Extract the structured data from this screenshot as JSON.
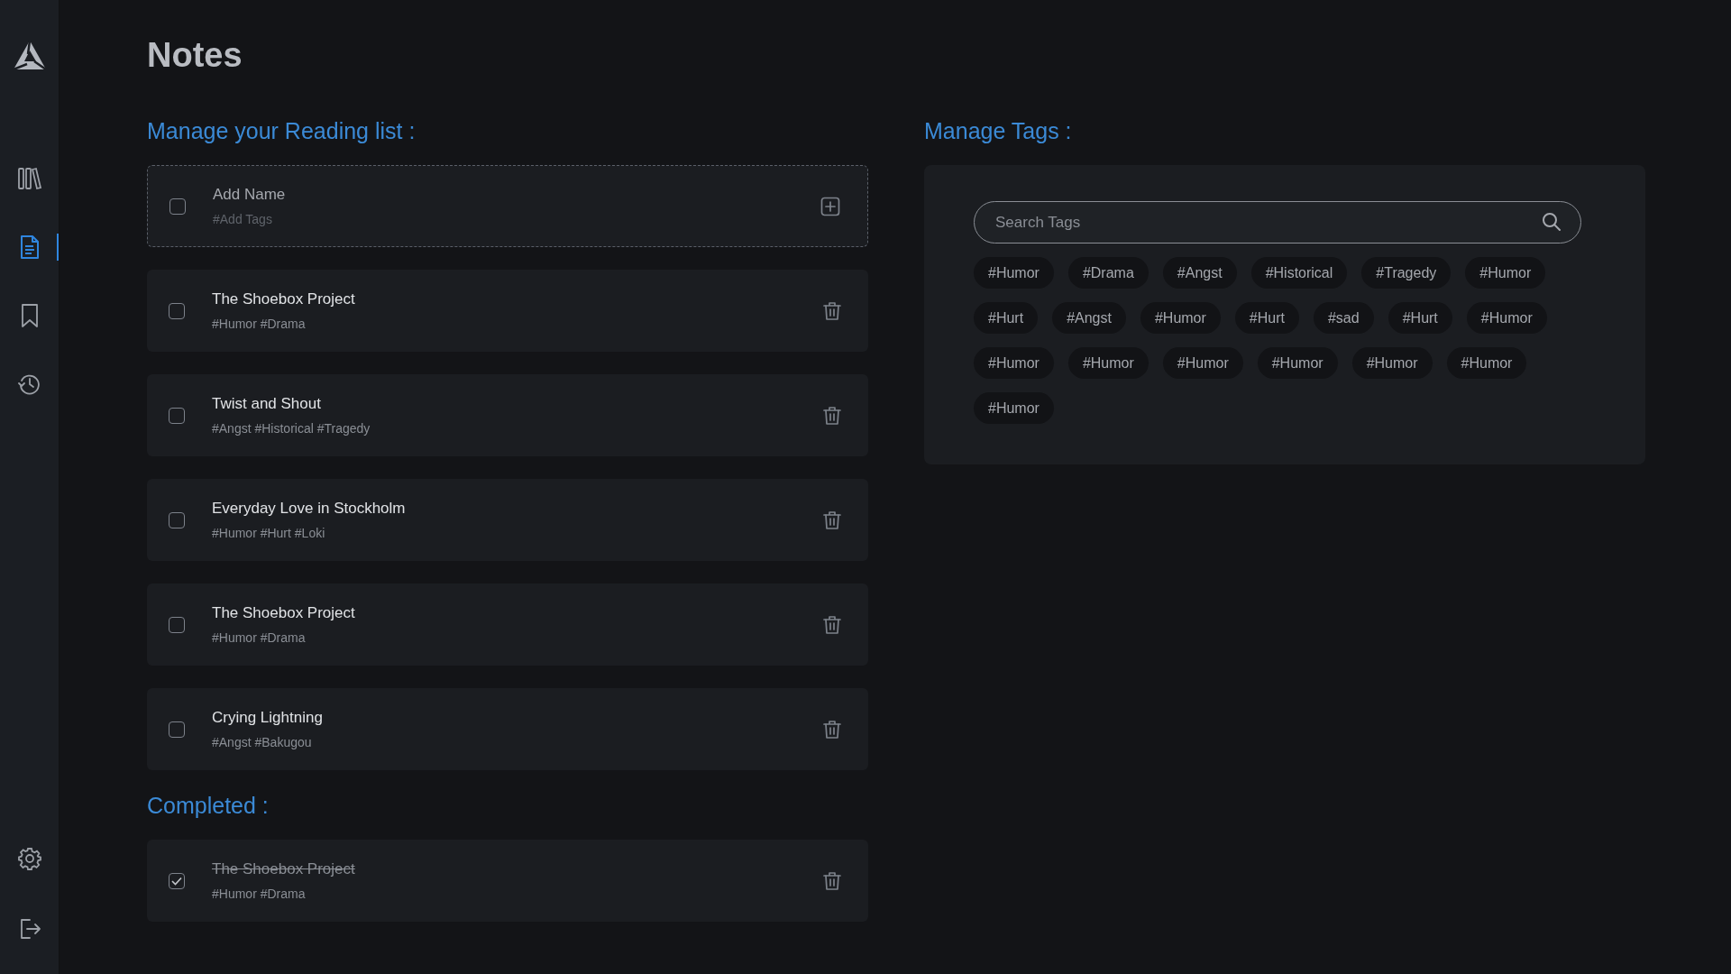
{
  "sidebar": {
    "nav": [
      {
        "kind": "library",
        "selected": false
      },
      {
        "kind": "notes",
        "selected": true
      },
      {
        "kind": "bookmark",
        "selected": false
      },
      {
        "kind": "history",
        "selected": false
      }
    ],
    "bottom": [
      {
        "kind": "settings"
      },
      {
        "kind": "logout"
      }
    ]
  },
  "page": {
    "title": "Notes"
  },
  "reading_list": {
    "heading": "Manage your Reading list :",
    "new_item": {
      "name_placeholder": "Add Name",
      "tags_placeholder": "#Add Tags",
      "checked": false
    },
    "items": [
      {
        "title": "The Shoebox Project",
        "tags": "#Humor #Drama",
        "checked": false
      },
      {
        "title": "Twist and Shout",
        "tags": "#Angst #Historical #Tragedy",
        "checked": false
      },
      {
        "title": "Everyday Love in Stockholm",
        "tags": "#Humor #Hurt #Loki",
        "checked": false
      },
      {
        "title": "The Shoebox Project",
        "tags": "#Humor #Drama",
        "checked": false
      },
      {
        "title": "Crying Lightning",
        "tags": "#Angst #Bakugou",
        "checked": false
      }
    ]
  },
  "completed": {
    "heading": "Completed :",
    "items": [
      {
        "title": "The Shoebox Project",
        "tags": "#Humor #Drama",
        "checked": true
      }
    ]
  },
  "tags": {
    "heading": "Manage Tags :",
    "search": {
      "placeholder": "Search Tags"
    },
    "chips": [
      "#Humor",
      "#Drama",
      "#Angst",
      "#Historical",
      "#Tragedy",
      "#Humor",
      "#Hurt",
      "#Angst",
      "#Humor",
      "#Hurt",
      "#sad",
      "#Hurt",
      "#Humor",
      "#Humor",
      "#Humor",
      "#Humor",
      "#Humor",
      "#Humor",
      "#Humor",
      "#Humor"
    ]
  }
}
